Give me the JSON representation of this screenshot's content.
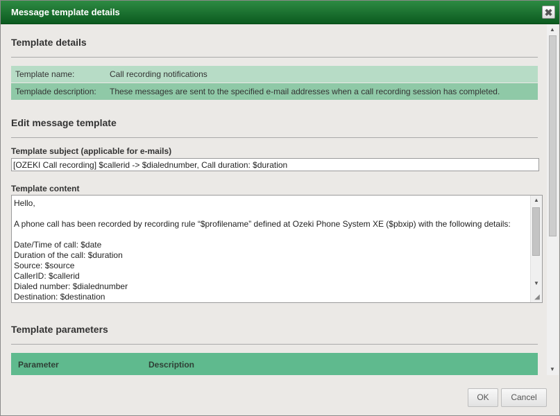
{
  "dialog": {
    "title": "Message template details",
    "close_label": "✖"
  },
  "template_details": {
    "heading": "Template details",
    "rows": [
      {
        "label": "Template name:",
        "value": "Call recording notifications"
      },
      {
        "label": "Templade description:",
        "value": "These messages are sent to the specified e-mail addresses when a call recording session has completed."
      }
    ]
  },
  "edit": {
    "heading": "Edit message template",
    "subject_label": "Template subject (applicable for e-mails)",
    "subject_value": "[OZEKI Call recording] $callerid -> $dialednumber, Call duration: $duration",
    "content_label": "Template content",
    "content_lines": [
      "Hello,",
      "",
      "A phone call has been recorded by recording rule “$profilename” defined at Ozeki Phone System XE ($pbxip) with the following details:",
      "",
      "Date/Time of call: $date",
      "Duration of the call: $duration",
      "Source: $source",
      "CallerID: $callerid",
      "Dialed number: $dialednumber",
      "Destination: $destination"
    ]
  },
  "parameters": {
    "heading": "Template parameters",
    "columns": [
      "Parameter",
      "Description"
    ]
  },
  "buttons": {
    "ok": "OK",
    "cancel": "Cancel"
  },
  "colors": {
    "title_bar": "#0b5a1f",
    "row_light": "#b7dcc6",
    "row_dark": "#8fc9a7",
    "table_header": "#5fba8e"
  }
}
